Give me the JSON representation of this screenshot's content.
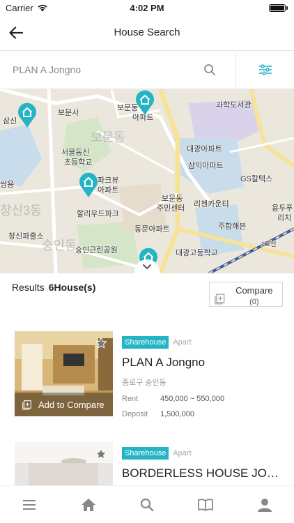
{
  "status_bar": {
    "carrier": "Carrier",
    "time": "4:02 PM"
  },
  "header": {
    "title": "House Search"
  },
  "search": {
    "value": "PLAN A Jongno"
  },
  "map": {
    "labels": [
      "보문사",
      "보문동",
      "서울동신",
      "초등학교",
      "과학도서관",
      "대광아파트",
      "삼익아파트",
      "GS칼텍스",
      "파크뷰",
      "아파트",
      "보문동",
      "주민센터",
      "리첸카운티",
      "할리우드파크",
      "창신파출소",
      "동문아파트",
      "주함해븐",
      "대광고등학교",
      "숭인근린공원",
      "용두푸",
      "리치",
      "쌍용",
      "삼신",
      "아파트",
      "보문동",
      "창신3동",
      "숭인동",
      "1호선"
    ]
  },
  "results": {
    "label": "Results",
    "count": "6",
    "unit": "House(s)"
  },
  "compare": {
    "label": "Compare",
    "count": "(0)"
  },
  "listings": [
    {
      "tag": "Sharehouse",
      "type": "Apart",
      "name": "PLAN A Jongno",
      "address": "종로구 숭인동",
      "rent_label": "Rent",
      "rent": "450,000 ~ 550,000",
      "deposit_label": "Deposit",
      "deposit": "1,500,000",
      "add_compare": "Add to Compare"
    },
    {
      "tag": "Sharehouse",
      "type": "Apart",
      "name": "BORDERLESS HOUSE JON···"
    }
  ],
  "colors": {
    "accent": "#23b5c6",
    "map_bg": "#ece7dc",
    "icon_gray": "#888888"
  },
  "tabbar": {
    "icons": [
      "menu-icon",
      "home-icon",
      "search-icon",
      "book-icon",
      "user-icon"
    ]
  }
}
